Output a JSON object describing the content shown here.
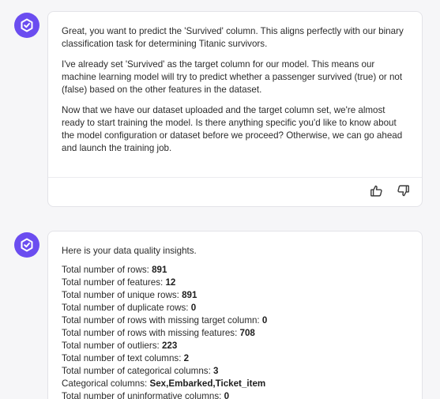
{
  "colors": {
    "avatar_bg": "#6b4df0",
    "bubble_bg": "#ffffff",
    "page_bg": "#f6f6f8"
  },
  "messages": [
    {
      "avatar_icon": "assistant-logo-icon",
      "paragraphs": [
        "Great, you want to predict the 'Survived' column. This aligns perfectly with our binary classification task for determining Titanic survivors.",
        "I've already set 'Survived' as the target column for our model. This means our machine learning model will try to predict whether a passenger survived (true) or not (false) based on the other features in the dataset.",
        "Now that we have our dataset uploaded and the target column set, we're almost ready to start training the model. Is there anything specific you'd like to know about the model configuration or dataset before we proceed? Otherwise, we can go ahead and launch the training job."
      ],
      "feedback": {
        "thumbs_up_icon": "thumbs-up-icon",
        "thumbs_down_icon": "thumbs-down-icon"
      }
    },
    {
      "avatar_icon": "assistant-logo-icon",
      "intro": "Here is your data quality insights.",
      "stats": [
        {
          "label": "Total number of rows: ",
          "value": "891"
        },
        {
          "label": "Total number of features: ",
          "value": "12"
        },
        {
          "label": "Total number of unique rows: ",
          "value": "891"
        },
        {
          "label": "Total number of duplicate rows: ",
          "value": "0"
        },
        {
          "label": "Total number of rows with missing target column: ",
          "value": "0"
        },
        {
          "label": "Total number of rows with missing features: ",
          "value": "708"
        },
        {
          "label": "Total number of outliers: ",
          "value": "223"
        },
        {
          "label": "Total number of text columns: ",
          "value": "2"
        },
        {
          "label": "Total number of categorical columns: ",
          "value": "3"
        },
        {
          "label": "Categorical columns: ",
          "value": "Sex,Embarked,Ticket_item"
        },
        {
          "label": "Total number of uninformative columns: ",
          "value": "0"
        }
      ]
    }
  ]
}
